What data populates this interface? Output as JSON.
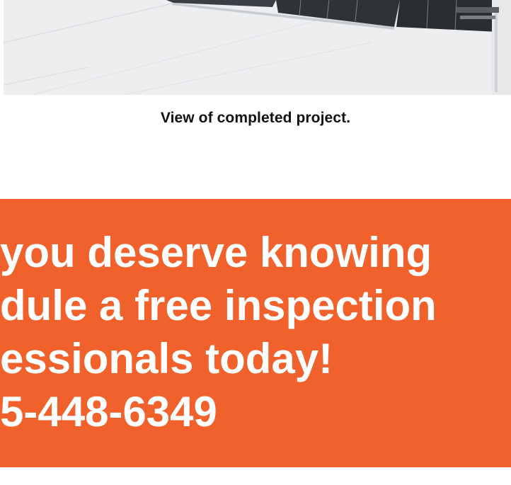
{
  "photo": {
    "alt_semantic": "completed-project-photo"
  },
  "caption": "View of completed project.",
  "cta": {
    "lines": [
      "you deserve knowing",
      "dule a free inspection",
      "essionals today!",
      "5-448-6349"
    ],
    "background_color": "#f0612b",
    "text_color": "#ffffff"
  }
}
